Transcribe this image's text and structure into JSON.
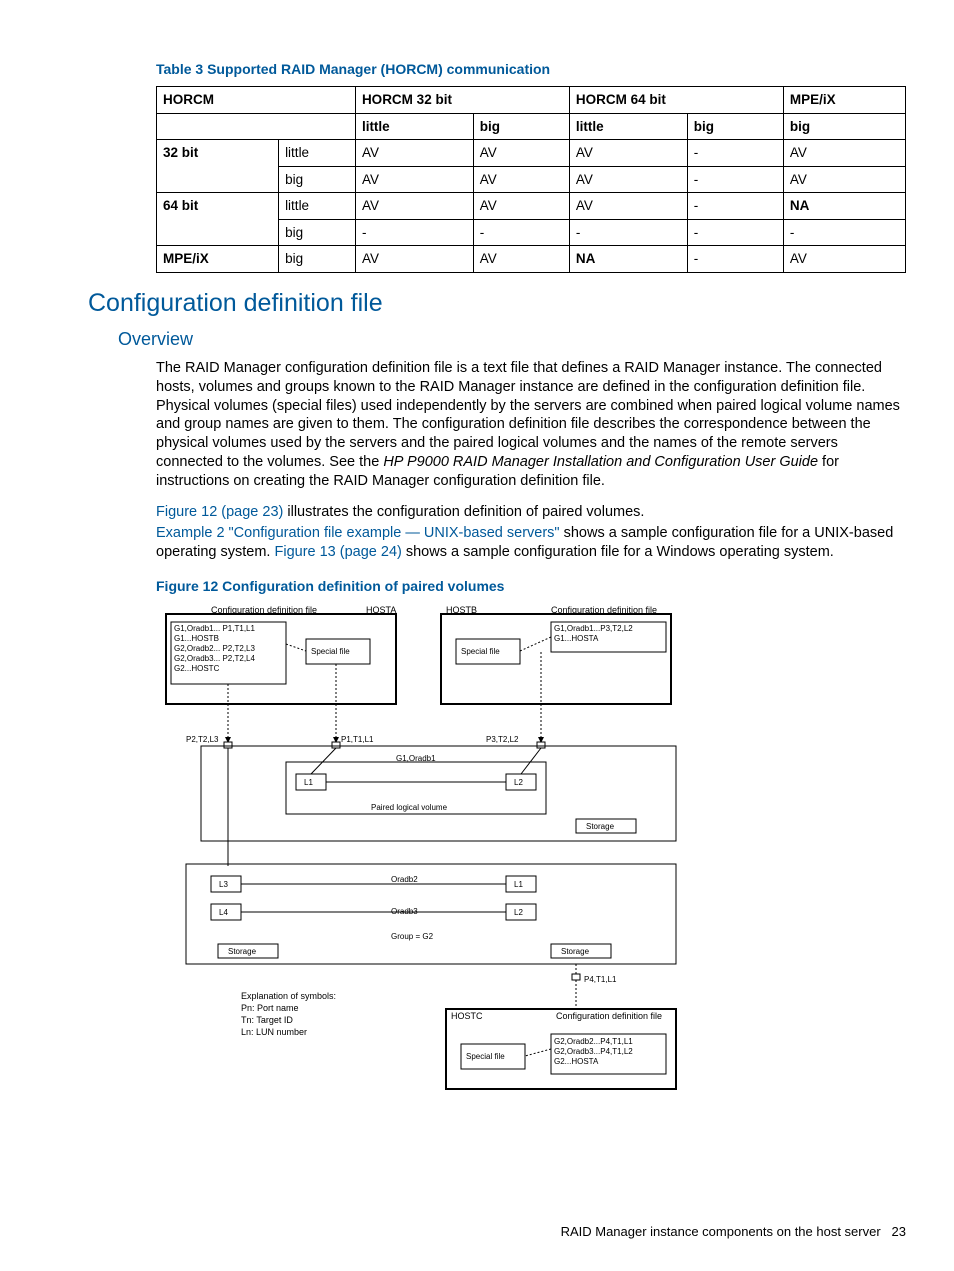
{
  "table_caption": "Table 3 Supported RAID Manager (HORCM) communication",
  "table": {
    "head_row1": [
      "HORCM",
      "HORCM 32 bit",
      "HORCM 64 bit",
      "MPE/iX"
    ],
    "head_row2": [
      "little",
      "big",
      "little",
      "big",
      "big"
    ],
    "rows": [
      {
        "r0": "32 bit",
        "r1": "little",
        "c": [
          "AV",
          "AV",
          "AV",
          "-",
          "AV"
        ]
      },
      {
        "r0": "",
        "r1": "big",
        "c": [
          "AV",
          "AV",
          "AV",
          "-",
          "AV"
        ]
      },
      {
        "r0": "64 bit",
        "r1": "little",
        "c": [
          "AV",
          "AV",
          "AV",
          "-",
          "NA"
        ],
        "bold": [
          4
        ]
      },
      {
        "r0": "",
        "r1": "big",
        "c": [
          "-",
          "-",
          "-",
          "-",
          "-"
        ]
      },
      {
        "r0": "MPE/iX",
        "r1": "big",
        "c": [
          "AV",
          "AV",
          "NA",
          "-",
          "AV"
        ],
        "bold": [
          2
        ]
      }
    ]
  },
  "h2": "Configuration definition file",
  "h3": "Overview",
  "para1_a": "The RAID Manager configuration definition file is a text file that defines a RAID Manager instance. The connected hosts, volumes and groups known to the RAID Manager instance are defined in the configuration definition file. Physical volumes (special files) used independently by the servers are combined when paired logical volume names and group names are given to them. The configuration definition file describes the correspondence between the physical volumes used by the servers and the paired logical volumes and the names of the remote servers connected to the volumes. See the ",
  "para1_ital": "HP P9000 RAID Manager Installation and Configuration User Guide",
  "para1_b": " for instructions on creating the RAID Manager configuration definition file.",
  "para2_link1": "Figure 12 (page 23)",
  "para2_a": " illustrates the configuration definition of paired volumes.",
  "para3_link1": "Example 2 \"Configuration file example — UNIX-based servers\"",
  "para3_a": " shows a sample configuration file for a UNIX-based operating system. ",
  "para3_link2": "Figure 13 (page 24)",
  "para3_b": " shows a sample configuration file for a Windows operating system.",
  "fig_caption": "Figure 12 Configuration definition of paired volumes",
  "fig": {
    "cfg_label": "Configuration definition file",
    "hosta": "HOSTA",
    "hostb": "HOSTB",
    "hostc": "HOSTC",
    "special_file": "Special file",
    "cfgA_lines": "G1,Oradb1... P1,T1,L1\nG1...HOSTB\nG2,Oradb2... P2,T2,L3\nG2,Oradb3... P2,T2,L4\nG2...HOSTC",
    "cfgB_lines": "G1,Oradb1...P3,T2,L2\nG1...HOSTA",
    "cfgC_lines": "G2,Oradb2...P4,T1,L1\nG2,Oradb3...P4,T1,L2\nG2...HOSTA",
    "p2t2l3": "P2,T2,L3",
    "p1t1l1": "P1,T1,L1",
    "p3t2l2": "P3,T2,L2",
    "p4t1l1": "P4,T1,L1",
    "g1oradb1": "G1,Oradb1",
    "oradb2": "Oradb2",
    "oradb3": "Oradb3",
    "groupg2": "Group = G2",
    "paired": "Paired logical volume",
    "storage": "Storage",
    "l1": "L1",
    "l2": "L2",
    "l3": "L3",
    "l4": "L4",
    "legend_t": "Explanation of symbols:",
    "legend_1": "Pn: Port name",
    "legend_2": "Tn: Target ID",
    "legend_3": "Ln: LUN number"
  },
  "footer_text": "RAID Manager instance components on the host server",
  "footer_page": "23"
}
